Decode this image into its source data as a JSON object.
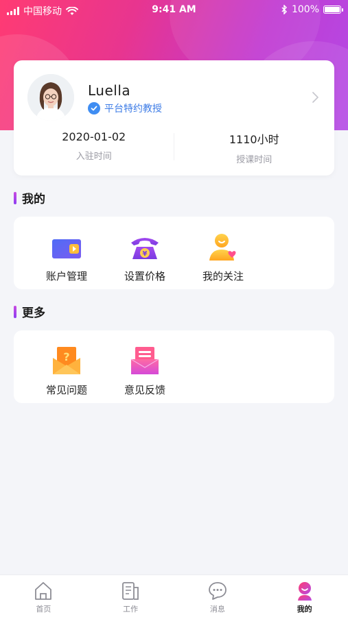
{
  "status_bar": {
    "carrier": "中国移动",
    "time": "9:41 AM",
    "battery": "100%"
  },
  "profile": {
    "name": "Luella",
    "title_badge": "平台特约教授",
    "stats": [
      {
        "value": "2020-01-02",
        "label": "入驻时间"
      },
      {
        "value": "1110小时",
        "label": "授课时间"
      }
    ]
  },
  "sections": {
    "mine": {
      "title": "我的",
      "items": [
        {
          "label": "账户管理",
          "icon": "wallet-icon"
        },
        {
          "label": "设置价格",
          "icon": "phone-price-icon"
        },
        {
          "label": "我的关注",
          "icon": "user-heart-icon"
        }
      ]
    },
    "more": {
      "title": "更多",
      "items": [
        {
          "label": "常见问题",
          "icon": "question-envelope-icon"
        },
        {
          "label": "意见反馈",
          "icon": "feedback-icon"
        }
      ]
    }
  },
  "tabbar": {
    "tabs": [
      {
        "label": "首页",
        "icon": "home-icon",
        "active": false
      },
      {
        "label": "工作",
        "icon": "work-icon",
        "active": false
      },
      {
        "label": "消息",
        "icon": "message-icon",
        "active": false
      },
      {
        "label": "我的",
        "icon": "profile-icon",
        "active": true
      }
    ]
  },
  "colors": {
    "brand_pink": "#ff3b73",
    "brand_purple": "#b44be6",
    "badge_blue": "#3c7be6"
  }
}
